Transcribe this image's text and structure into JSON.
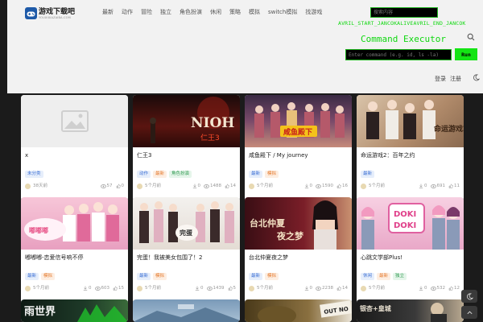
{
  "header": {
    "logo_title": "游戏下载吧",
    "logo_subtitle": "YOUXIXIAZAIBA.COM",
    "nav": [
      "最新",
      "动作",
      "冒险",
      "独立",
      "角色扮演",
      "休闲",
      "策略",
      "模拟",
      "switch模拟",
      "找游戏"
    ],
    "search_placeholder": "搜索内容",
    "avril_text": "AVRIL_START_JANCOKALIVEAVRIL_END_JANCOK",
    "command_title": "Command Executor",
    "command_placeholder": "Enter command (e.g. id, ls -la)",
    "run_label": "Run",
    "login_label": "登录",
    "register_label": "注册"
  },
  "colors": {
    "terminal_green": "#0fd80f",
    "run_button": "#14e414",
    "tag_blue": "#3b6fd4",
    "tag_orange": "#e57b2f",
    "tag_green": "#2f9a50"
  },
  "cards": [
    {
      "title": "x",
      "tags": [
        {
          "label": "未分类",
          "color": "blue"
        }
      ],
      "date": "38天前",
      "downloads": "",
      "views": "57",
      "likes": "0"
    },
    {
      "title": "仁王3",
      "tags": [
        {
          "label": "动作",
          "color": "blue"
        },
        {
          "label": "最新",
          "color": "orange"
        },
        {
          "label": "角色扮演",
          "color": "green"
        }
      ],
      "date": "5个月前",
      "downloads": "0",
      "views": "1488",
      "likes": "14"
    },
    {
      "title": "咸鱼殿下 / My journey",
      "tags": [
        {
          "label": "最新",
          "color": "blue"
        },
        {
          "label": "模拟",
          "color": "orange"
        }
      ],
      "date": "5个月前",
      "downloads": "0",
      "views": "1590",
      "likes": "16"
    },
    {
      "title": "命运游戏2：百年之约",
      "tags": [
        {
          "label": "最新",
          "color": "blue"
        }
      ],
      "date": "5个月前",
      "downloads": "0",
      "views": "691",
      "likes": "11"
    },
    {
      "title": "嘟嘟嘟-恋爱信号响不停",
      "tags": [
        {
          "label": "最新",
          "color": "blue"
        },
        {
          "label": "模拟",
          "color": "orange"
        }
      ],
      "date": "5个月前",
      "downloads": "0",
      "views": "603",
      "likes": "15"
    },
    {
      "title": "完蛋！我被美女包围了！2",
      "tags": [
        {
          "label": "最新",
          "color": "blue"
        },
        {
          "label": "模拟",
          "color": "orange"
        }
      ],
      "date": "5个月前",
      "downloads": "0",
      "views": "1439",
      "likes": "5"
    },
    {
      "title": "台北仲夏夜之梦",
      "tags": [
        {
          "label": "最新",
          "color": "blue"
        },
        {
          "label": "模拟",
          "color": "orange"
        }
      ],
      "date": "5个月前",
      "downloads": "0",
      "views": "2238",
      "likes": "14"
    },
    {
      "title": "心跳文学部Plus!",
      "tags": [
        {
          "label": "休闲",
          "color": "blue"
        },
        {
          "label": "最新",
          "color": "orange"
        },
        {
          "label": "独立",
          "color": "green"
        }
      ],
      "date": "5个月前",
      "downloads": "0",
      "views": "532",
      "likes": "12"
    }
  ],
  "partial_row": {
    "card9_text": "雨世界",
    "card12_text_1": "银杏+皇城",
    "card12_text_2": "OUT NO"
  }
}
